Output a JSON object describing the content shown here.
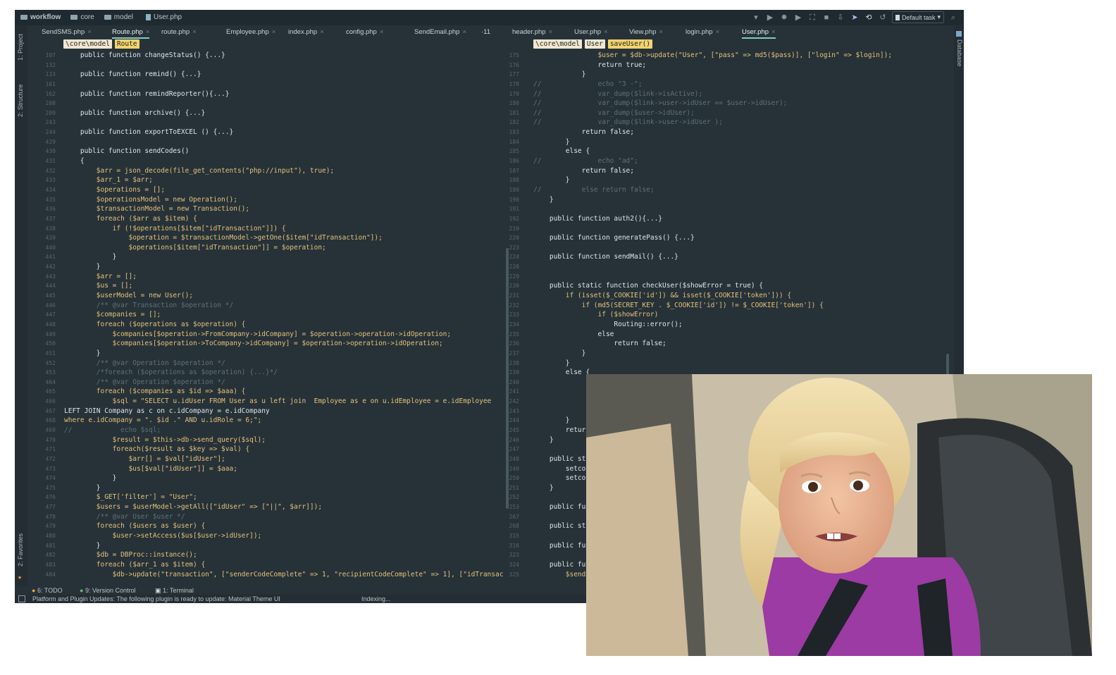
{
  "breadcrumb": [
    "workflow",
    "core",
    "model",
    "User.php"
  ],
  "toolbar": {
    "run_config": "Default task"
  },
  "tabs": [
    {
      "label": "SendSMS.php",
      "active": false
    },
    {
      "label": "Route.php",
      "active": true
    },
    {
      "label": "route.php",
      "active": false
    },
    {
      "label": "Employee.php",
      "active": false
    },
    {
      "label": "index.php",
      "active": false
    },
    {
      "label": "config.php",
      "active": false
    },
    {
      "label": "SendEmail.php",
      "active": false
    },
    {
      "label": "·11",
      "active": false
    },
    {
      "label": "header.php",
      "active": false
    },
    {
      "label": "User.php",
      "active": false
    },
    {
      "label": "View.php",
      "active": false
    },
    {
      "label": "login.php",
      "active": false
    },
    {
      "label": "User.php",
      "active": true
    }
  ],
  "side_panels": {
    "project": "1: Project",
    "structure": "2: Structure",
    "favorites": "2: Favorites",
    "database": "Database"
  },
  "left_nav": [
    "\\core\\model",
    "Route"
  ],
  "right_nav": [
    "\\core\\model",
    "User",
    "saveUser()"
  ],
  "left_lines": [
    "107",
    "132",
    "133",
    "161",
    "162",
    "208",
    "209",
    "243",
    "244",
    "429",
    "430",
    "431",
    "432",
    "433",
    "434",
    "435",
    "436",
    "437",
    "438",
    "439",
    "440",
    "441",
    "442",
    "443",
    "444",
    "445",
    "446",
    "447",
    "448",
    "449",
    "450",
    "451",
    "452",
    "453",
    "464",
    "465",
    "466",
    "467",
    "468",
    "469",
    "470",
    "471",
    "472",
    "473",
    "474",
    "475",
    "476",
    "477",
    "478",
    "479",
    "480",
    "481",
    "482",
    "483",
    "484"
  ],
  "left_code": [
    "    public function changeStatus() {...}",
    "",
    "    public function remind() {...}",
    "",
    "    public function remindReporter(){...}",
    "",
    "    public function archive() {...}",
    "",
    "    public function exportToEXCEL () {...}",
    "",
    "    public function sendCodes()",
    "    {",
    "        $arr = json_decode(file_get_contents(\"php://input\"), true);",
    "        $arr_1 = $arr;",
    "        $operations = [];",
    "        $operationsModel = new Operation();",
    "        $transactionModel = new Transaction();",
    "        foreach ($arr as $item) {",
    "            if (!$operations[$item[\"idTransaction\"]]) {",
    "                $operation = $transactionModel->getOne($item[\"idTransaction\"]);",
    "                $operations[$item[\"idTransaction\"]] = $operation;",
    "            }",
    "        }",
    "        $arr = [];",
    "        $us = [];",
    "        $userModel = new User();",
    "        /** @var Transaction $operation */",
    "        $companies = [];",
    "        foreach ($operations as $operation) {",
    "            $companies[$operation->FromCompany->idCompany] = $operation->operation->idOperation;",
    "            $companies[$operation->ToCompany->idCompany] = $operation->operation->idOperation;",
    "        }",
    "        /** @var Operation $operation */",
    "        /*foreach ($operations as $operation) {...}*/",
    "        /** @var Operation $operation */",
    "        foreach ($companies as $id => $aaa) {",
    "            $sql = \"SELECT u.idUser FROM User as u left join  Employee as e on u.idEmployee = e.idEmployee",
    "LEFT JOIN Company as c on c.idCompany = e.idCompany",
    "where e.idCompany = \". $id .\" AND u.idRole = 6;\";",
    "//            echo $sql;",
    "            $result = $this->db->send_query($sql);",
    "            foreach($result as $key => $val) {",
    "                $arr[] = $val[\"idUser\"];",
    "                $us[$val[\"idUser\"]] = $aaa;",
    "            }",
    "        }",
    "        $_GET['filter'] = \"User\";",
    "        $users = $userModel->getAll([\"idUser\" => [\"||\", $arr]]);",
    "        /** @var User $user */",
    "        foreach ($users as $user) {",
    "            $user->setAccess($us[$user->idUser]);",
    "        }",
    "        $db = DBProc::instance();",
    "        foreach ($arr_1 as $item) {",
    "            $db->update(\"transaction\", [\"senderCodeComplete\" => 1, \"recipientCodeComplete\" => 1], [\"idTransac"
  ],
  "right_lines": [
    "175",
    "176",
    "177",
    "178",
    "179",
    "180",
    "181",
    "182",
    "183",
    "184",
    "185",
    "186",
    "187",
    "188",
    "189",
    "190",
    "191",
    "192",
    "219",
    "220",
    "223",
    "224",
    "228",
    "229",
    "230",
    "231",
    "232",
    "233",
    "234",
    "235",
    "236",
    "237",
    "238",
    "239",
    "240",
    "241",
    "242",
    "243",
    "244",
    "245",
    "246",
    "247",
    "248",
    "249",
    "250",
    "251",
    "252",
    "253",
    "267",
    "268",
    "315",
    "316",
    "323",
    "324",
    "325"
  ],
  "right_code": [
    "                $user = $db->update(\"User\", [\"pass\" => md5($pass)], [\"login\" => $login]);",
    "                return true;",
    "            }",
    "//              echo \"3 -\";",
    "//              var_dump($link->isActive);",
    "//              var_dump($link->user->idUser == $user->idUser);",
    "//              var_dump($user->idUser);",
    "//              var_dump($link->user->idUser );",
    "            return false;",
    "        }",
    "        else {",
    "//              echo \"ad\";",
    "            return false;",
    "        }",
    "//          else return false;",
    "    }",
    "",
    "    public function auth2(){...}",
    "",
    "    public function generatePass() {...}",
    "",
    "    public function sendMail() {...}",
    "",
    "",
    "    public static function checkUser($showError = true) {",
    "        if (isset($_COOKIE['id']) && isset($_COOKIE['token'])) {",
    "            if (md5(SECRET_KEY . $_COOKIE['id']) != $_COOKIE['token']) {",
    "                if ($showError)",
    "                    Routing::error();",
    "                else",
    "                    return false;",
    "            }",
    "        }",
    "        else {",
    "",
    "",
    "",
    "",
    "        }",
    "        return",
    "    }",
    "",
    "    public st",
    "        setco",
    "        setco",
    "    }",
    "",
    "    public fu",
    "",
    "    public st",
    "",
    "    public fu",
    "",
    "    public fu",
    "        $send"
  ],
  "bottom_tabs": [
    "6: TODO",
    "9: Version Control",
    "1: Terminal"
  ],
  "status": {
    "message": "Platform and Plugin Updates: The following plugin is ready to update: Material Theme UI",
    "progress": "Indexing..."
  }
}
